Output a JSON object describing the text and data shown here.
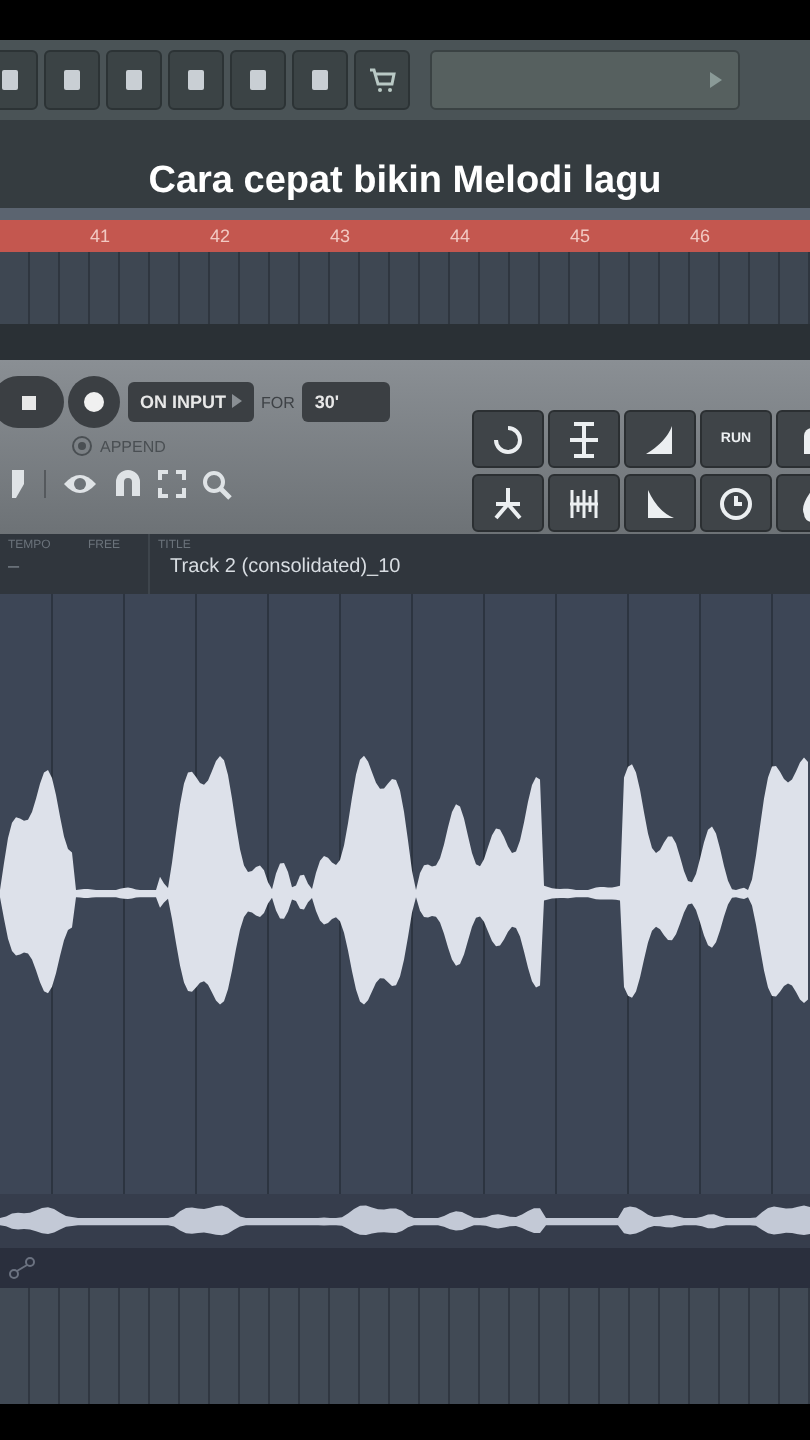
{
  "caption": "Cara cepat bikin Melodi lagu",
  "timeline": {
    "bars": [
      "41",
      "42",
      "43",
      "44",
      "45",
      "46"
    ]
  },
  "recorder": {
    "mode": "ON INPUT",
    "for_label": "FOR",
    "duration": "30'",
    "append": {
      "label": "APPEND",
      "checked": true
    }
  },
  "tools": {
    "run_label": "RUN"
  },
  "info": {
    "tempo_label": "TEMPO",
    "tempo_value": "–",
    "free_label": "FREE",
    "title_label": "TITLE",
    "title_value": "Track 2 (consolidated)_10"
  }
}
